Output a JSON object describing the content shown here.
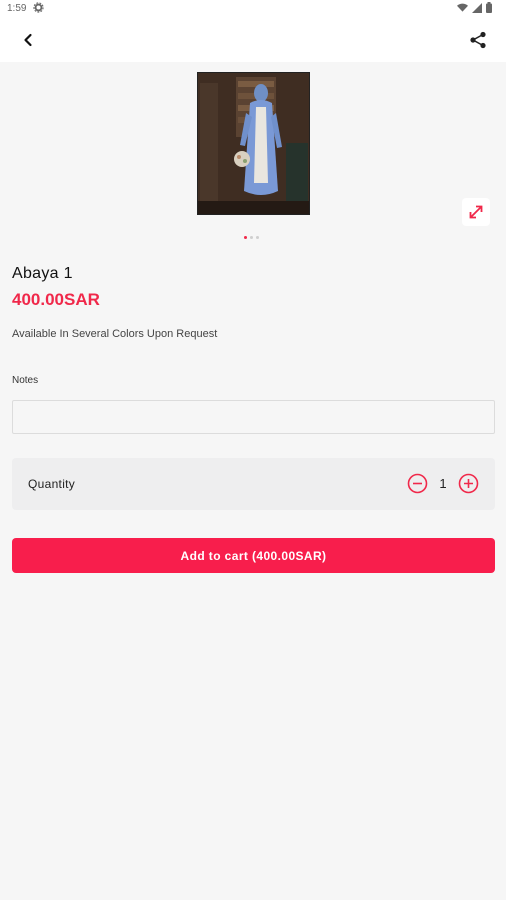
{
  "status_bar": {
    "time": "1:59",
    "icons": [
      "gear-icon",
      "wifi-icon",
      "signal-icon",
      "battery-icon"
    ]
  },
  "app_bar": {
    "back_icon": "chevron-left-icon",
    "share_icon": "share-icon"
  },
  "product": {
    "title": "Abaya 1",
    "price": "400.00SAR",
    "description": "Available In Several Colors Upon Request",
    "image_count": 3,
    "active_image": 0
  },
  "notes": {
    "label": "Notes",
    "value": "",
    "placeholder": ""
  },
  "quantity": {
    "label": "Quantity",
    "value": "1"
  },
  "cart": {
    "button_label": "Add to cart (400.00SAR)"
  },
  "colors": {
    "accent": "#f81e4c",
    "price": "#f0284a",
    "background": "#f6f6f6"
  }
}
